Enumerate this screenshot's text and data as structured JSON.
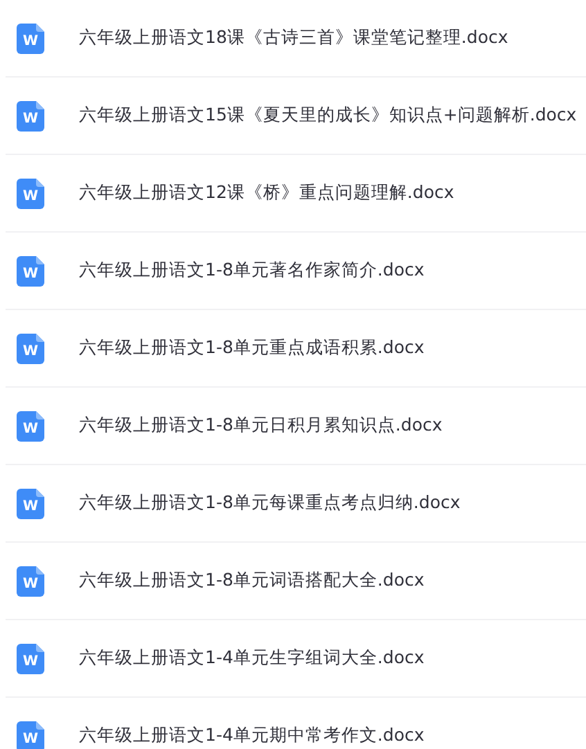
{
  "files": [
    {
      "icon": "W",
      "name": "六年级上册语文18课《古诗三首》课堂笔记整理.docx"
    },
    {
      "icon": "W",
      "name": "六年级上册语文15课《夏天里的成长》知识点+问题解析.docx"
    },
    {
      "icon": "W",
      "name": "六年级上册语文12课《桥》重点问题理解.docx"
    },
    {
      "icon": "W",
      "name": "六年级上册语文1-8单元著名作家简介.docx"
    },
    {
      "icon": "W",
      "name": "六年级上册语文1-8单元重点成语积累.docx"
    },
    {
      "icon": "W",
      "name": "六年级上册语文1-8单元日积月累知识点.docx"
    },
    {
      "icon": "W",
      "name": "六年级上册语文1-8单元每课重点考点归纳.docx"
    },
    {
      "icon": "W",
      "name": "六年级上册语文1-8单元词语搭配大全.docx"
    },
    {
      "icon": "W",
      "name": "六年级上册语文1-4单元生字组词大全.docx"
    },
    {
      "icon": "W",
      "name": "六年级上册语文1-4单元期中常考作文.docx"
    }
  ]
}
